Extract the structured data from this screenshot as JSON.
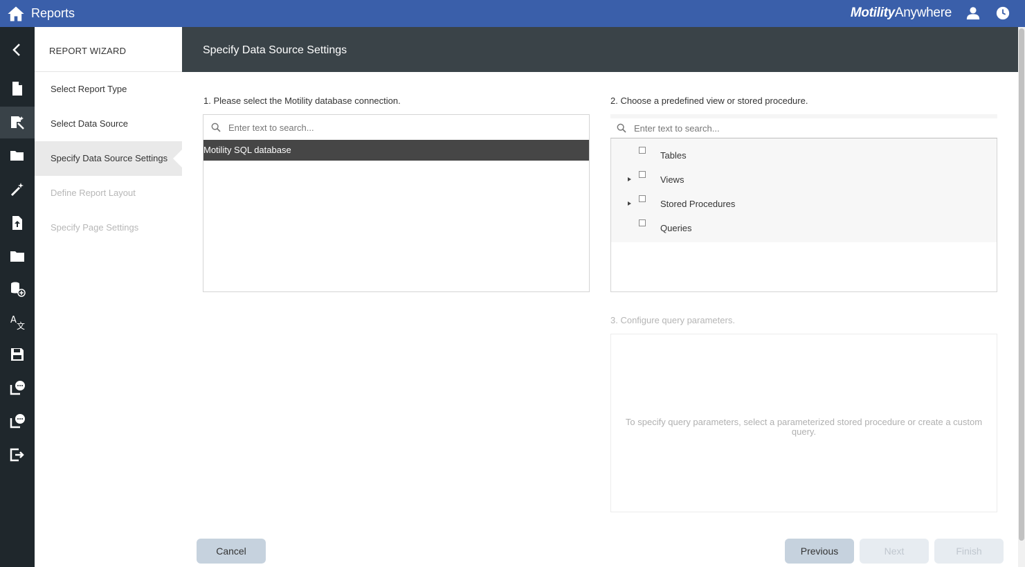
{
  "topbar": {
    "title": "Reports",
    "brand_bold": "Motility",
    "brand_rest": "Anywhere"
  },
  "rail": {
    "icons": [
      "back-chevron-icon",
      "document-icon",
      "report-wizard-icon",
      "open-folder-icon",
      "magic-wand-icon",
      "upload-file-icon",
      "folder-icon",
      "add-database-icon",
      "translate-icon",
      "save-icon",
      "chat-report-icon",
      "chat-report-icon",
      "exit-icon"
    ]
  },
  "wizard": {
    "heading": "REPORT WIZARD",
    "steps": [
      {
        "label": "Select Report Type",
        "state": "done"
      },
      {
        "label": "Select Data Source",
        "state": "done"
      },
      {
        "label": "Specify Data Source Settings",
        "state": "current"
      },
      {
        "label": "Define Report Layout",
        "state": "disabled"
      },
      {
        "label": "Specify Page Settings",
        "state": "disabled"
      }
    ]
  },
  "main": {
    "title": "Specify Data Source Settings",
    "section1": {
      "label": "1. Please select the Motility database connection.",
      "search_placeholder": "Enter text to search...",
      "connections": [
        "Motility SQL database"
      ]
    },
    "section2": {
      "label": "2. Choose a predefined view or stored procedure.",
      "search_placeholder": "Enter text to search...",
      "tree": [
        {
          "label": "Tables",
          "expandable": false
        },
        {
          "label": "Views",
          "expandable": true
        },
        {
          "label": "Stored Procedures",
          "expandable": true
        },
        {
          "label": "Queries",
          "expandable": false
        }
      ]
    },
    "section3": {
      "label": "3. Configure query parameters.",
      "empty_message": "To specify query parameters, select a parameterized stored procedure or create a custom query."
    }
  },
  "footer": {
    "cancel": "Cancel",
    "previous": "Previous",
    "next": "Next",
    "finish": "Finish"
  },
  "colors": {
    "topbar": "#3a5faa",
    "rail": "#1f272c",
    "header": "#3a4348",
    "selected_row": "#464646",
    "button": "#c6d2de"
  }
}
